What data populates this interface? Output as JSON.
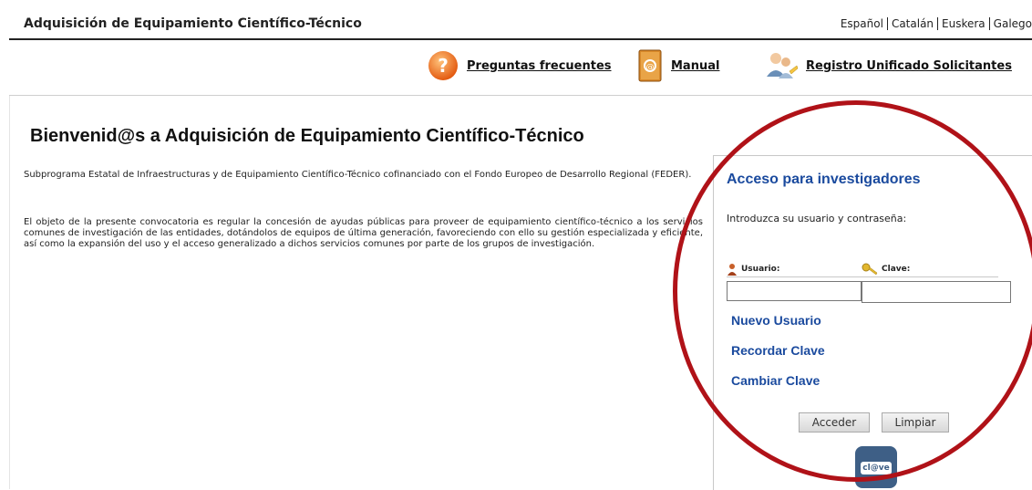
{
  "header": {
    "app_title": "Adquisición de Equipamiento Científico-Técnico",
    "languages": [
      "Español",
      "Catalán",
      "Euskera",
      "Galego"
    ]
  },
  "nav": {
    "faq_label": "Preguntas frecuentes",
    "manual_label": "Manual",
    "registro_label": "Registro Unificado Solicitantes"
  },
  "main": {
    "welcome_title": "Bienvenid@s a Adquisición de Equipamiento Científico-Técnico",
    "paragraph1": "Subprograma Estatal de Infraestructuras y de Equipamiento Científico-Técnico cofinanciado con el Fondo Europeo de Desarrollo Regional (FEDER).",
    "paragraph2": "El objeto de la presente convocatoria es regular la concesión de ayudas públicas para proveer de equipamiento científico-técnico a los servicios comunes de investigación de las entidades, dotándolos de equipos de última generación, favoreciendo con ello su gestión especializada y eficiente, así como la expansión del uso y el acceso generalizado a dichos servicios comunes por parte de los grupos de investigación."
  },
  "login": {
    "title": "Acceso para investigadores",
    "help": "Introduzca su usuario y contraseña:",
    "usuario_label": "Usuario:",
    "clave_label": "Clave:",
    "usuario_value": "",
    "clave_value": "",
    "nuevo_usuario": "Nuevo Usuario",
    "recordar_clave": "Recordar Clave",
    "cambiar_clave": "Cambiar Clave",
    "acceder_button": "Acceder",
    "limpiar_button": "Limpiar",
    "clave_logo_text": "cl@ve"
  },
  "colors": {
    "link_blue": "#1a4a9e",
    "highlight_red": "#b01218"
  },
  "icons": [
    "question-icon",
    "manual-book-icon",
    "users-icon",
    "user-icon",
    "key-icon",
    "clave-logo-icon"
  ]
}
